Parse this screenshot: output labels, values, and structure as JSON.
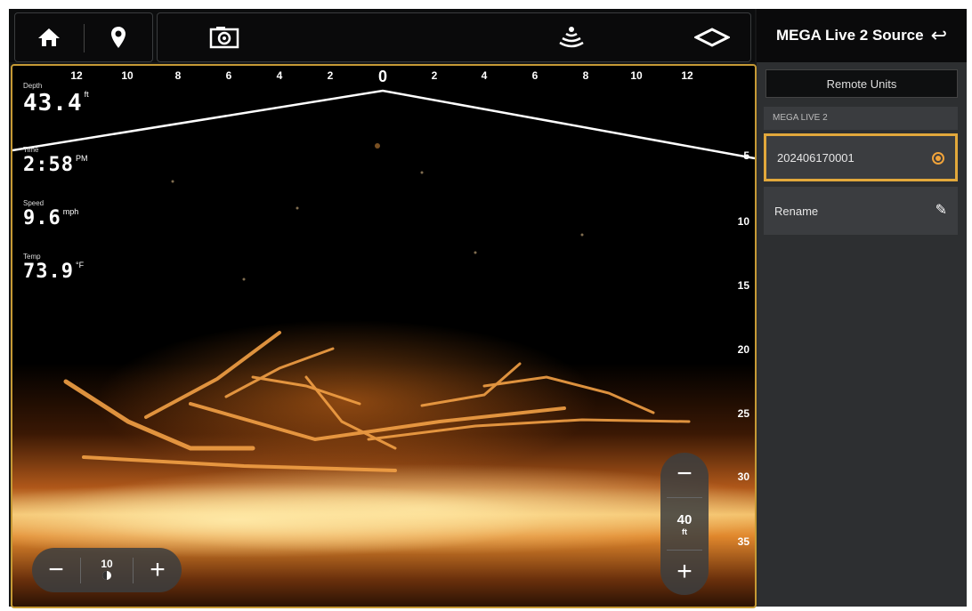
{
  "panel": {
    "title": "MEGA Live 2 Source",
    "remote_tab": "Remote Units",
    "section": "MEGA LIVE 2",
    "device_id": "202406170001",
    "rename": "Rename"
  },
  "topbar": {
    "icons": [
      "home-icon",
      "waypoint-icon",
      "camera-icon",
      "sonar-icon",
      "view-cone-icon"
    ]
  },
  "sonar": {
    "top_scale": [
      "12",
      "10",
      "8",
      "6",
      "4",
      "2",
      "0",
      "2",
      "4",
      "6",
      "8",
      "10",
      "12"
    ],
    "depth_scale": [
      "5",
      "10",
      "15",
      "20",
      "25",
      "30",
      "35"
    ],
    "readouts": {
      "depth": {
        "label": "Depth",
        "value": "43.4",
        "unit": "ft"
      },
      "time": {
        "label": "Time",
        "value": "2:58",
        "unit": "PM"
      },
      "speed": {
        "label": "Speed",
        "value": "9.6",
        "unit": "mph"
      },
      "temp": {
        "label": "Temp",
        "value": "73.9",
        "unit": "°F"
      }
    },
    "zoom": {
      "minus": "−",
      "plus": "+",
      "value": "10"
    },
    "range": {
      "minus": "−",
      "plus": "+",
      "value": "40",
      "unit": "ft"
    }
  },
  "colors": {
    "accent": "#e2a83b",
    "sonar_glow": "#f3c06a"
  }
}
